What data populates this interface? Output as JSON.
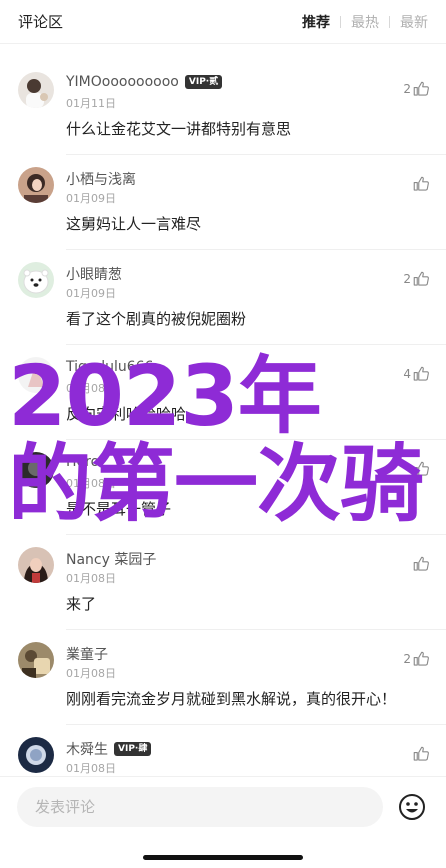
{
  "header": {
    "title": "评论区",
    "tabs": [
      {
        "label": "推荐",
        "active": true
      },
      {
        "label": "最热",
        "active": false
      },
      {
        "label": "最新",
        "active": false
      }
    ]
  },
  "comments": [
    {
      "name": "YIMOooooooooo",
      "vip": "VIP·贰",
      "date": "01月11日",
      "text": "什么让金花艾文一讲都特别有意思",
      "likes": "2"
    },
    {
      "name": "小栖与浅离",
      "vip": "",
      "date": "01月09日",
      "text": "这舅妈让人一言难尽",
      "likes": ""
    },
    {
      "name": "小眼睛葱",
      "vip": "",
      "date": "01月09日",
      "text": "看了这个剧真的被倪妮圈粉",
      "likes": "2"
    },
    {
      "name": "Tigerlulu666",
      "vip": "",
      "date": "01月08日",
      "text": "反向安利哈哈哈哈",
      "likes": "4"
    },
    {
      "name": "Hero",
      "vip": "",
      "date": "01月08日",
      "text": "是不是耳一管子",
      "likes": ""
    },
    {
      "name": "Nancy 菜园子",
      "vip": "",
      "date": "01月08日",
      "text": "来了",
      "likes": ""
    },
    {
      "name": "業童子",
      "vip": "",
      "date": "01月08日",
      "text": "刚刚看完流金岁月就碰到黑水解说，真的很开心！",
      "likes": "2"
    },
    {
      "name": "木舜生",
      "vip": "VIP·肆",
      "date": "01月08日",
      "text": "",
      "likes": ""
    }
  ],
  "overlay": {
    "line1": "2023年",
    "line2": "的第一次骑"
  },
  "input": {
    "placeholder": "发表评论"
  },
  "colors": {
    "accent": "#8e2bd6",
    "vip_badge": "#333333"
  },
  "icons": {
    "like": "thumbs-up-icon",
    "emoji": "smiley-icon"
  }
}
